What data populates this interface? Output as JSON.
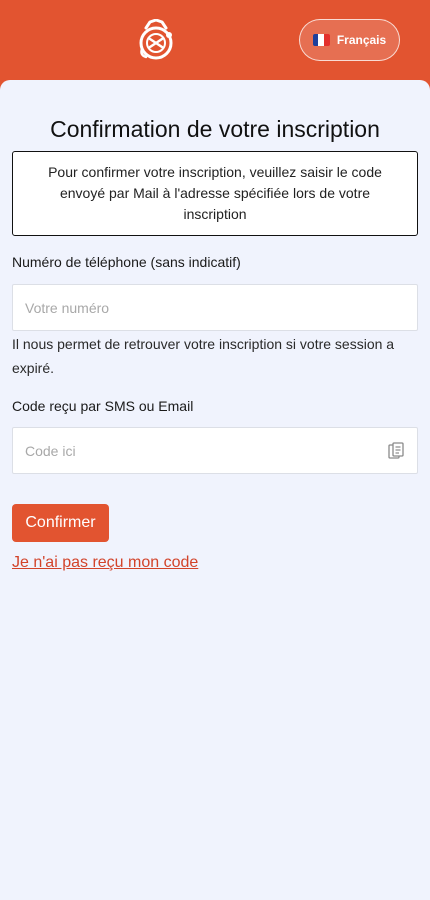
{
  "header": {
    "language": {
      "label": "Français",
      "flag_colors": [
        "#1f3f9b",
        "#ffffff",
        "#e3302c"
      ]
    }
  },
  "main": {
    "title": "Confirmation de votre inscription",
    "info": "Pour confirmer votre inscription, veuillez saisir le code envoyé par Mail à l'adresse spécifiée lors de votre inscription",
    "phone": {
      "label": "Numéro de téléphone (sans indicatif)",
      "placeholder": "Votre numéro",
      "value": "",
      "help": "Il nous permet de retrouver votre inscription si votre session a expiré."
    },
    "code": {
      "label": "Code reçu par SMS ou Email",
      "placeholder": "Code ici",
      "value": "",
      "icon": "paste-icon"
    },
    "confirm_label": "Confirmer",
    "resend_label": "Je n'ai pas reçu mon code"
  },
  "colors": {
    "accent": "#e25430",
    "page_background": "#f0f3fd",
    "link": "#d2432a"
  }
}
